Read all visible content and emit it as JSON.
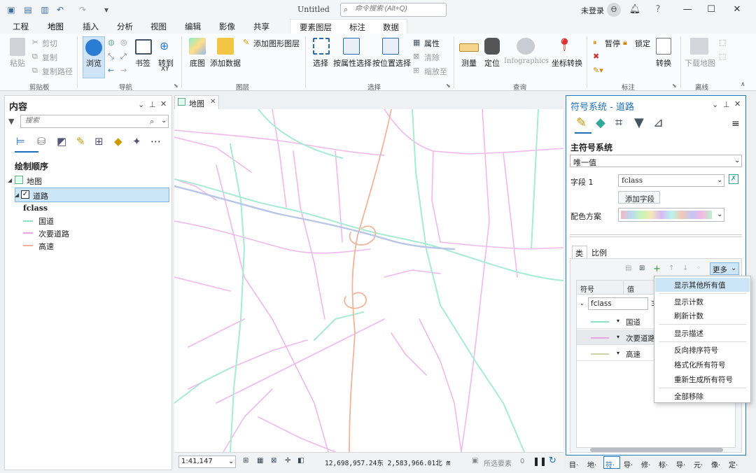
{
  "titlebar": {
    "doc_title": "Untitled",
    "search_placeholder": "命令搜索 (Alt+Q)",
    "user": "未登录"
  },
  "tabs": [
    "工程",
    "地图",
    "插入",
    "分析",
    "视图",
    "编辑",
    "影像",
    "共享"
  ],
  "context_tabs": [
    "要素图层",
    "标注",
    "数据"
  ],
  "ribbon": {
    "clipboard": {
      "paste": "粘贴",
      "cut": "剪切",
      "copy": "复制",
      "copy_path": "复制路径",
      "group": "剪贴板"
    },
    "navigate": {
      "explore": "浏览",
      "bookmarks": "书签",
      "goto_xy": "转到",
      "goto_xy2": "XY",
      "group": "导航"
    },
    "layer": {
      "basemap": "底图",
      "add_data": "添加数据",
      "add_graphics": "添加图形图层",
      "group": "图层"
    },
    "selection": {
      "select": "选择",
      "by_attr": "按属性选择",
      "by_loc": "按位置选择",
      "attributes": "属性",
      "clear": "清除",
      "zoom_to": "缩放至",
      "group": "选择"
    },
    "inquiry": {
      "measure": "测量",
      "locate": "定位",
      "infographics": "Infographics",
      "coord": "坐标转换",
      "group": "查询"
    },
    "labeling": {
      "pause": "暂停",
      "lock": "锁定",
      "convert": "转换",
      "group": "标注"
    },
    "offline": {
      "download": "下载地图",
      "group": "离线"
    }
  },
  "contents": {
    "title": "内容",
    "search_placeholder": "搜索",
    "drawing_order": "绘制顺序",
    "map": "地图",
    "layer": "道路",
    "field": "fclass",
    "legend": [
      {
        "label": "国道",
        "color": "#8fe3c4"
      },
      {
        "label": "次要道路",
        "color": "#e9a3e6"
      },
      {
        "label": "高速",
        "color": "#f0b39a"
      }
    ]
  },
  "map_tab": "地图",
  "status": {
    "scale": "1:41,147",
    "coords": "12,698,957.24东 2,583,966.01北 m",
    "selected": "所选要素",
    "count": "0"
  },
  "symbology": {
    "title": "符号系统 - 道路",
    "primary": "主符号系统",
    "method": "唯一值",
    "field_label": "字段 1",
    "field_value": "fclass",
    "add_field": "添加字段",
    "scheme_label": "配色方案",
    "sub_tabs": [
      "类",
      "比例"
    ],
    "more": "更多",
    "col_symbol": "符号",
    "col_value": "值",
    "group_value": "fclass",
    "group_count": "3",
    "rows": [
      {
        "label": "国道",
        "color": "#8fe3c4"
      },
      {
        "label": "次要道路",
        "color": "#e9a3e6"
      },
      {
        "label": "高速",
        "color": "#c8d6a8"
      }
    ]
  },
  "menu": [
    "显示其他所有值",
    "显示计数",
    "刷新计数",
    "显示描述",
    "反向排序符号",
    "格式化所有符号",
    "重新生成所有符号",
    "全部移除"
  ],
  "bottom_tabs": [
    "目·",
    "地·",
    "符·",
    "导·",
    "修·",
    "标·",
    "导·",
    "元·",
    "像·",
    "定·"
  ]
}
